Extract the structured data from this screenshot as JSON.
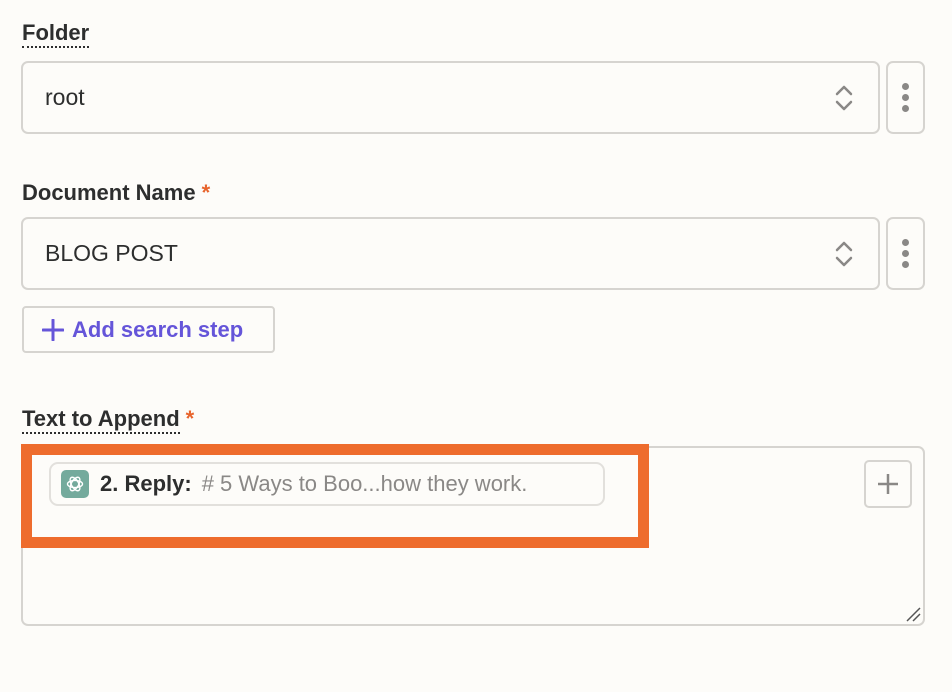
{
  "fields": {
    "folder": {
      "label": "Folder",
      "value": "root",
      "required": false
    },
    "document_name": {
      "label": "Document Name",
      "value": "BLOG POST",
      "required": true,
      "required_mark": "*"
    },
    "add_search_step": {
      "label": "Add search step"
    },
    "text_to_append": {
      "label": "Text to Append",
      "required": true,
      "required_mark": "*",
      "chip": {
        "app_icon": "openai-icon",
        "step_label": "2. Reply:",
        "preview": "# 5 Ways to Boo...how they work."
      }
    }
  },
  "colors": {
    "accent": "#6555d9",
    "required": "#e8642c",
    "highlight": "#ee6c2d",
    "openai_icon_bg": "#74aa9c",
    "background": "#fdfcf9"
  }
}
